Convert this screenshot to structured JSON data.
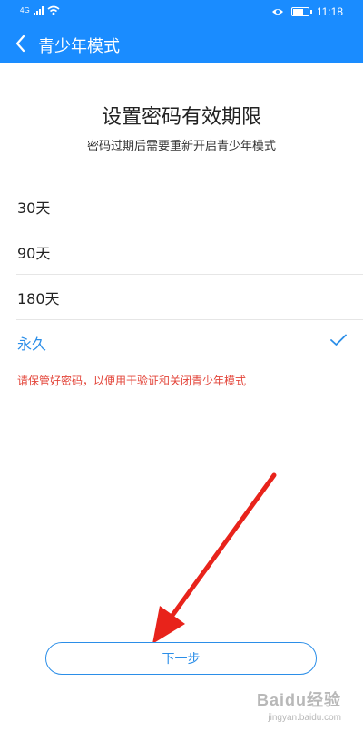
{
  "status_bar": {
    "network": "4G",
    "time": "11:18",
    "icons": [
      "signal-icon",
      "wifi-icon",
      "eye-icon",
      "battery-icon"
    ]
  },
  "header": {
    "title": "青少年模式",
    "back_icon": "chevron-left-icon"
  },
  "main": {
    "heading": "设置密码有效期限",
    "subheading": "密码过期后需要重新开启青少年模式",
    "options": [
      {
        "label": "30天",
        "selected": false
      },
      {
        "label": "90天",
        "selected": false
      },
      {
        "label": "180天",
        "selected": false
      },
      {
        "label": "永久",
        "selected": true
      }
    ],
    "note": "请保管好密码，以便用于验证和关闭青少年模式",
    "next_button": "下一步"
  },
  "watermark": {
    "brand": "Baidu经验",
    "url": "jingyan.baidu.com"
  },
  "colors": {
    "header_bg": "#1a8cff",
    "accent": "#2b8ee8",
    "warning": "#e3453a",
    "annotation_arrow": "#e8231b"
  }
}
